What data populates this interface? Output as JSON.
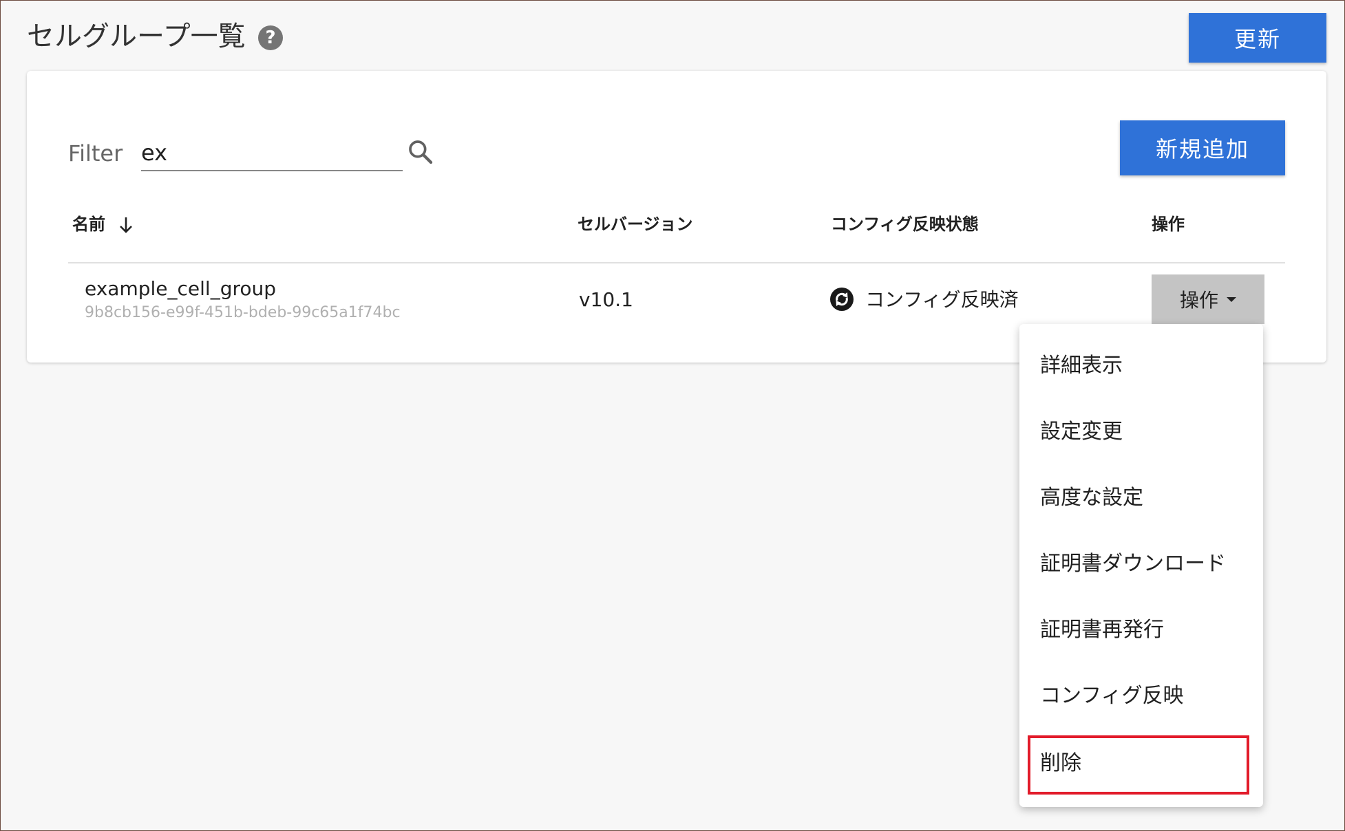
{
  "header": {
    "title": "セルグループ一覧",
    "help_icon": "help-circle-icon",
    "refresh_label": "更新"
  },
  "filter": {
    "label": "Filter",
    "value": "ex",
    "search_icon": "search-icon"
  },
  "add_button_label": "新規追加",
  "table": {
    "columns": [
      "名前",
      "セルバージョン",
      "コンフィグ反映状態",
      "操作"
    ],
    "sort_column": "名前",
    "sort_direction": "descending",
    "rows": [
      {
        "name": "example_cell_group",
        "id": "9b8cb156-e99f-451b-bdeb-99c65a1f74bc",
        "version": "v10.1",
        "config_status": "コンフィグ反映済",
        "status_icon": "sync-icon",
        "action_label": "操作"
      }
    ]
  },
  "action_menu": {
    "items": [
      "詳細表示",
      "設定変更",
      "高度な設定",
      "証明書ダウンロード",
      "証明書再発行",
      "コンフィグ反映",
      "削除"
    ],
    "highlighted_item": "削除"
  },
  "colors": {
    "primary": "#2f72d8",
    "highlight": "#e21b2a",
    "action_button_bg": "#c4c4c4"
  }
}
